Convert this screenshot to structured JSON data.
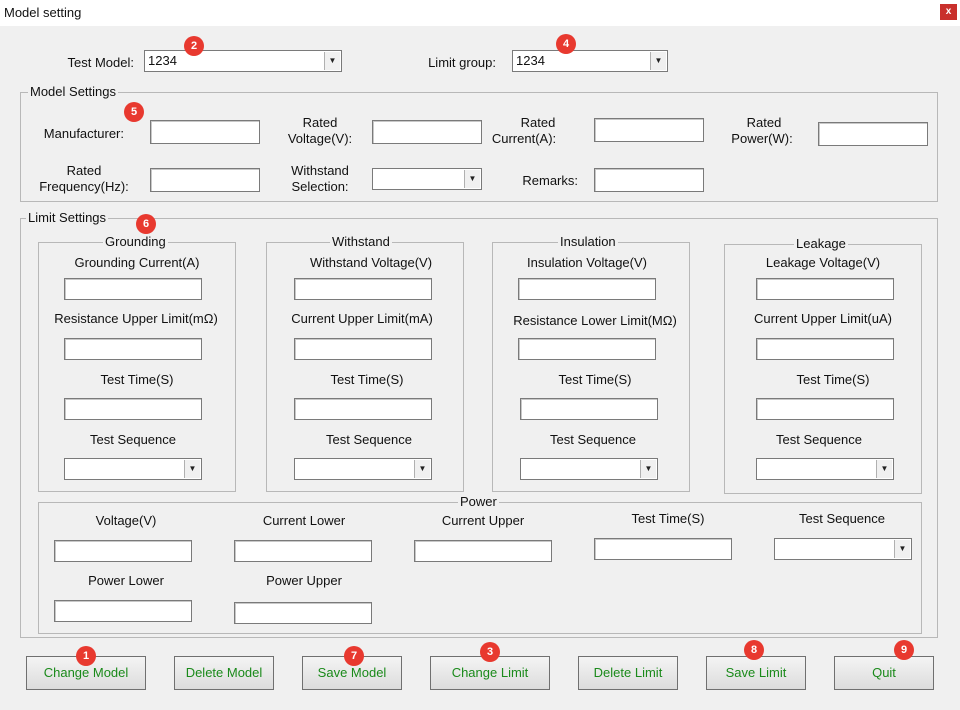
{
  "window": {
    "title": "Model setting",
    "close": "x"
  },
  "top": {
    "test_model_label": "Test Model:",
    "test_model_value": "1234",
    "limit_group_label": "Limit group:",
    "limit_group_value": "1234"
  },
  "model_settings": {
    "title": "Model Settings",
    "manufacturer": "Manufacturer:",
    "rated_voltage_1": "Rated",
    "rated_voltage_2": "Voltage(V):",
    "rated_current_1": "Rated",
    "rated_current_2": "Current(A):",
    "rated_power_1": "Rated",
    "rated_power_2": "Power(W):",
    "rated_freq_1": "Rated",
    "rated_freq_2": "Frequency(Hz):",
    "withstand_sel_1": "Withstand",
    "withstand_sel_2": "Selection:",
    "remarks": "Remarks:"
  },
  "limit_settings": {
    "title": "Limit Settings",
    "grounding": {
      "title": "Grounding",
      "f1": "Grounding Current(A)",
      "f2": "Resistance Upper Limit(mΩ)",
      "f3": "Test Time(S)",
      "f4": "Test Sequence"
    },
    "withstand": {
      "title": "Withstand",
      "f1": "Withstand Voltage(V)",
      "f2": "Current Upper Limit(mA)",
      "f3": "Test Time(S)",
      "f4": "Test Sequence"
    },
    "insulation": {
      "title": "Insulation",
      "f1": "Insulation Voltage(V)",
      "f2": "Resistance Lower Limit(MΩ)",
      "f3": "Test Time(S)",
      "f4": "Test Sequence"
    },
    "leakage": {
      "title": "Leakage",
      "f1": "Leakage Voltage(V)",
      "f2": "Current Upper Limit(uA)",
      "f3": "Test Time(S)",
      "f4": "Test Sequence"
    },
    "power": {
      "title": "Power",
      "voltage": "Voltage(V)",
      "current_lower": "Current Lower",
      "current_upper": "Current Upper",
      "test_time": "Test Time(S)",
      "test_sequence": "Test Sequence",
      "power_lower": "Power Lower",
      "power_upper": "Power Upper"
    }
  },
  "buttons": {
    "change_model": "Change Model",
    "delete_model": "Delete Model",
    "save_model": "Save Model",
    "change_limit": "Change Limit",
    "delete_limit": "Delete Limit",
    "save_limit": "Save Limit",
    "quit": "Quit"
  },
  "badges": {
    "b1": "1",
    "b2": "2",
    "b3": "3",
    "b4": "4",
    "b5": "5",
    "b6": "6",
    "b7": "7",
    "b8": "8",
    "b9": "9"
  },
  "icons": {
    "dropdown": "▼"
  },
  "colors": {
    "button_text": "#1a8a1a",
    "badge": "#e8392f",
    "close": "#c9302c"
  }
}
